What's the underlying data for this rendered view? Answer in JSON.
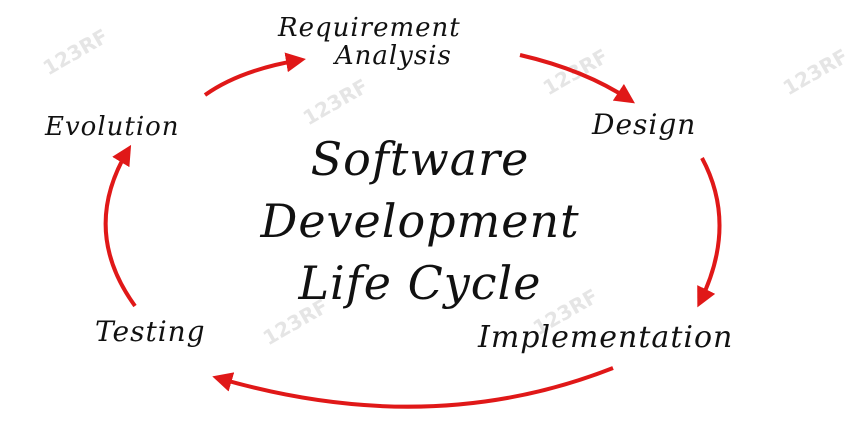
{
  "diagram": {
    "title_lines": [
      "Software",
      "Development",
      "Life Cycle"
    ],
    "stages": {
      "requirement_analysis": [
        "Requirement",
        "Analysis"
      ],
      "design": "Design",
      "implementation": "Implementation",
      "testing": "Testing",
      "evolution": "Evolution"
    },
    "colors": {
      "arrow": "#e01818",
      "text": "#111111"
    }
  },
  "watermarks": [
    "123RF",
    "123RF",
    "123RF",
    "123RF",
    "123RF",
    "123RF"
  ]
}
